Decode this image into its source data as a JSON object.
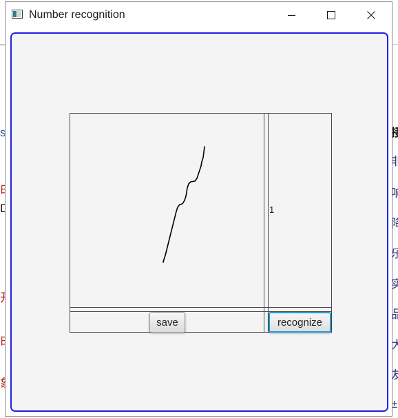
{
  "window": {
    "title": "Number recognition",
    "accent_color": "#2020e0",
    "icon": "app-window-icon"
  },
  "controls": {
    "minimize_icon": "minimize-icon",
    "maximize_icon": "maximize-icon",
    "close_icon": "close-icon"
  },
  "canvas": {
    "stroke_color": "#000000",
    "drawing": "handwritten digit stroke"
  },
  "result": {
    "value": "1"
  },
  "buttons": {
    "save_label": "save",
    "recognize_label": "recognize",
    "recognize_focus_color": "#1f9bd6"
  },
  "background": {
    "left_fragments": [
      "s",
      "由",
      "D",
      "开",
      "由",
      "象"
    ],
    "left_colors": [
      "#3050a0",
      "#c02020",
      "#202020",
      "#c02020",
      "#c02020",
      "#c02020"
    ],
    "right_fragments": [
      "接",
      "非",
      "响",
      "降",
      "乐",
      "实",
      "品",
      "大",
      "友",
      "±"
    ],
    "right_color": "#2b3a7a"
  }
}
